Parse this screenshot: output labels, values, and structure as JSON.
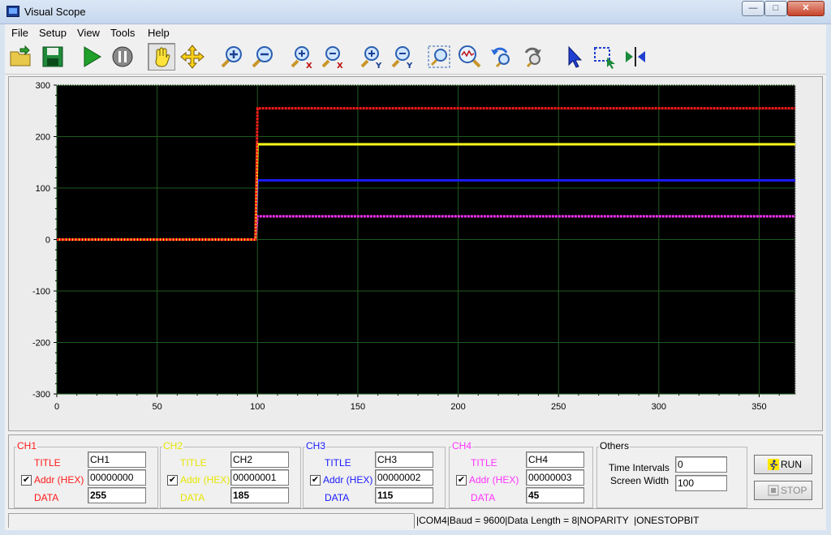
{
  "window": {
    "title": "Visual Scope",
    "minimize_glyph": "—",
    "maximize_glyph": "□",
    "close_glyph": "✕"
  },
  "menu": [
    "File",
    "Setup",
    "View",
    "Tools",
    "Help"
  ],
  "toolbar": {
    "buttons": [
      "open-folder-icon",
      "save-icon",
      "run-icon",
      "pause-icon",
      "hand-pan-icon",
      "move-arrows-icon",
      "zoom-in-icon",
      "zoom-out-icon",
      "zoom-in-x-icon",
      "zoom-out-x-icon",
      "zoom-in-y-icon",
      "zoom-out-y-icon",
      "zoom-fit-icon",
      "zoom-auto-icon",
      "zoom-undo-icon",
      "zoom-redo-icon",
      "pointer-icon",
      "select-region-icon",
      "cursor-split-icon"
    ]
  },
  "chart_data": {
    "type": "line",
    "title": "",
    "xlabel": "",
    "ylabel": "",
    "xlim": [
      0,
      368
    ],
    "ylim": [
      -300,
      300
    ],
    "x_ticks": [
      0,
      50,
      100,
      150,
      200,
      250,
      300,
      350
    ],
    "y_ticks": [
      300,
      200,
      100,
      0,
      -100,
      -200,
      -300
    ],
    "grid": true,
    "background": "#000000",
    "grid_color": "#1e5a1e",
    "series": [
      {
        "name": "CH1",
        "color": "#ff1a1a",
        "x": [
          0,
          99,
          100,
          368
        ],
        "y": [
          0,
          0,
          255,
          255
        ]
      },
      {
        "name": "CH2",
        "color": "#ffff1a",
        "x": [
          0,
          99,
          100,
          368
        ],
        "y": [
          0,
          0,
          185,
          185
        ]
      },
      {
        "name": "CH3",
        "color": "#1a1aff",
        "x": [
          0,
          99,
          100,
          368
        ],
        "y": [
          0,
          0,
          115,
          115
        ]
      },
      {
        "name": "CH4",
        "color": "#ff33ff",
        "x": [
          0,
          99,
          100,
          368
        ],
        "y": [
          0,
          0,
          45,
          45
        ]
      }
    ]
  },
  "channels": [
    {
      "name": "CH1",
      "color": "#ff1a1a",
      "title_label": "TITLE",
      "addr_label": "Addr (HEX)",
      "data_label": "DATA",
      "title": "CH1",
      "addr": "00000000",
      "data": "255",
      "checked": true
    },
    {
      "name": "CH2",
      "color": "#e6e600",
      "title_label": "TITLE",
      "addr_label": "Addr (HEX)",
      "data_label": "DATA",
      "title": "CH2",
      "addr": "00000001",
      "data": "185",
      "checked": true
    },
    {
      "name": "CH3",
      "color": "#1a1aff",
      "title_label": "TITLE",
      "addr_label": "Addr (HEX)",
      "data_label": "DATA",
      "title": "CH3",
      "addr": "00000002",
      "data": "115",
      "checked": true
    },
    {
      "name": "CH4",
      "color": "#ff33ff",
      "title_label": "TITLE",
      "addr_label": "Addr (HEX)",
      "data_label": "DATA",
      "title": "CH4",
      "addr": "00000003",
      "data": "45",
      "checked": true
    }
  ],
  "others": {
    "title": "Others",
    "time_intervals_label": "Time Intervals",
    "time_intervals": "0",
    "screen_width_label": "Screen Width",
    "screen_width": "100"
  },
  "controls": {
    "run_label": "RUN",
    "stop_label": "STOP"
  },
  "status": "|COM4|Baud = 9600|Data Length = 8|NOPARITY  |ONESTOPBIT"
}
